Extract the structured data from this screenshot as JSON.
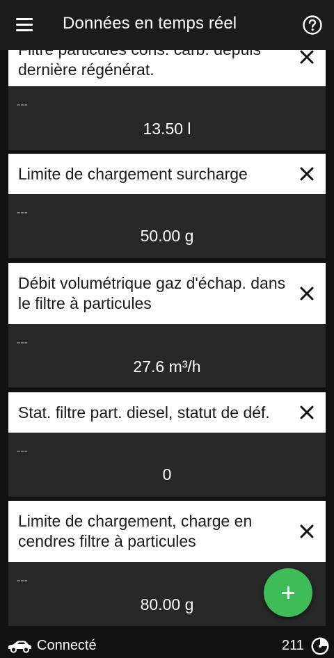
{
  "appbar": {
    "title": "Données en temps réel",
    "menu_icon": "menu-icon",
    "help_icon": "help-circle-icon"
  },
  "cards": [
    {
      "label": "Filtre particules cons. carb. depuis dernière régénérat.",
      "placeholder": "---",
      "value": "13.50 l"
    },
    {
      "label": "Limite de chargement surcharge",
      "placeholder": "---",
      "value": "50.00 g"
    },
    {
      "label": "Débit volumétrique gaz d'échap. dans le filtre à particules",
      "placeholder": "---",
      "value": "27.6 m³/h"
    },
    {
      "label": "Stat. filtre part. diesel, statut de déf.",
      "placeholder": "---",
      "value": "0"
    },
    {
      "label": "Limite de chargement, charge en cendres filtre à particules",
      "placeholder": "---",
      "value": "80.00 g"
    }
  ],
  "fab": {
    "icon": "plus-icon"
  },
  "statusbar": {
    "connection_icon": "car-icon",
    "connection_status": "Connecté",
    "count": "211",
    "count_icon": "gauge-icon"
  },
  "colors": {
    "background": "#111111",
    "appbar": "#1b1b1b",
    "card_header": "#ffffff",
    "card_body": "#272727",
    "fab": "#3fbb57"
  }
}
